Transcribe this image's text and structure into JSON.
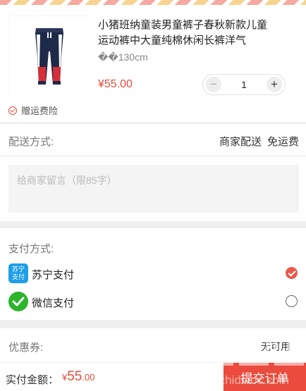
{
  "product": {
    "title": "小猪班纳童装男童裤子春秋新款儿童运动裤中大童纯棉休闲长裤洋气",
    "spec": "��130cm",
    "price": "¥55.00",
    "quantity": "1",
    "minus_label": "−",
    "plus_label": "+",
    "insurance_label": "赠运费险",
    "image_icon": "pants-product-image"
  },
  "delivery": {
    "label": "配送方式:",
    "method": "商家配送",
    "fee": "免运费"
  },
  "message": {
    "placeholder": "给商家留言（限85字）",
    "value": ""
  },
  "payment": {
    "label": "支付方式:",
    "options": [
      {
        "name": "苏宁支付",
        "icon_text": "苏宁支付",
        "icon": "suning-pay-icon",
        "selected": true
      },
      {
        "name": "微信支付",
        "icon": "wechat-pay-icon",
        "selected": false
      }
    ]
  },
  "coupon": {
    "label": "优惠券:",
    "value": "无可用"
  },
  "footer": {
    "total_label": "实付金额：",
    "currency": "¥",
    "amount_int": "55",
    "amount_dec": ".00",
    "submit_label": "提交订单"
  },
  "watermark": {
    "text": "zhizhidiaoc.com",
    "icon": "site-watermark-logo"
  },
  "colors": {
    "accent": "#ea4b3c",
    "price": "#e74c3c",
    "suning": "#1e9fe8",
    "wechat": "#2bb52a"
  }
}
